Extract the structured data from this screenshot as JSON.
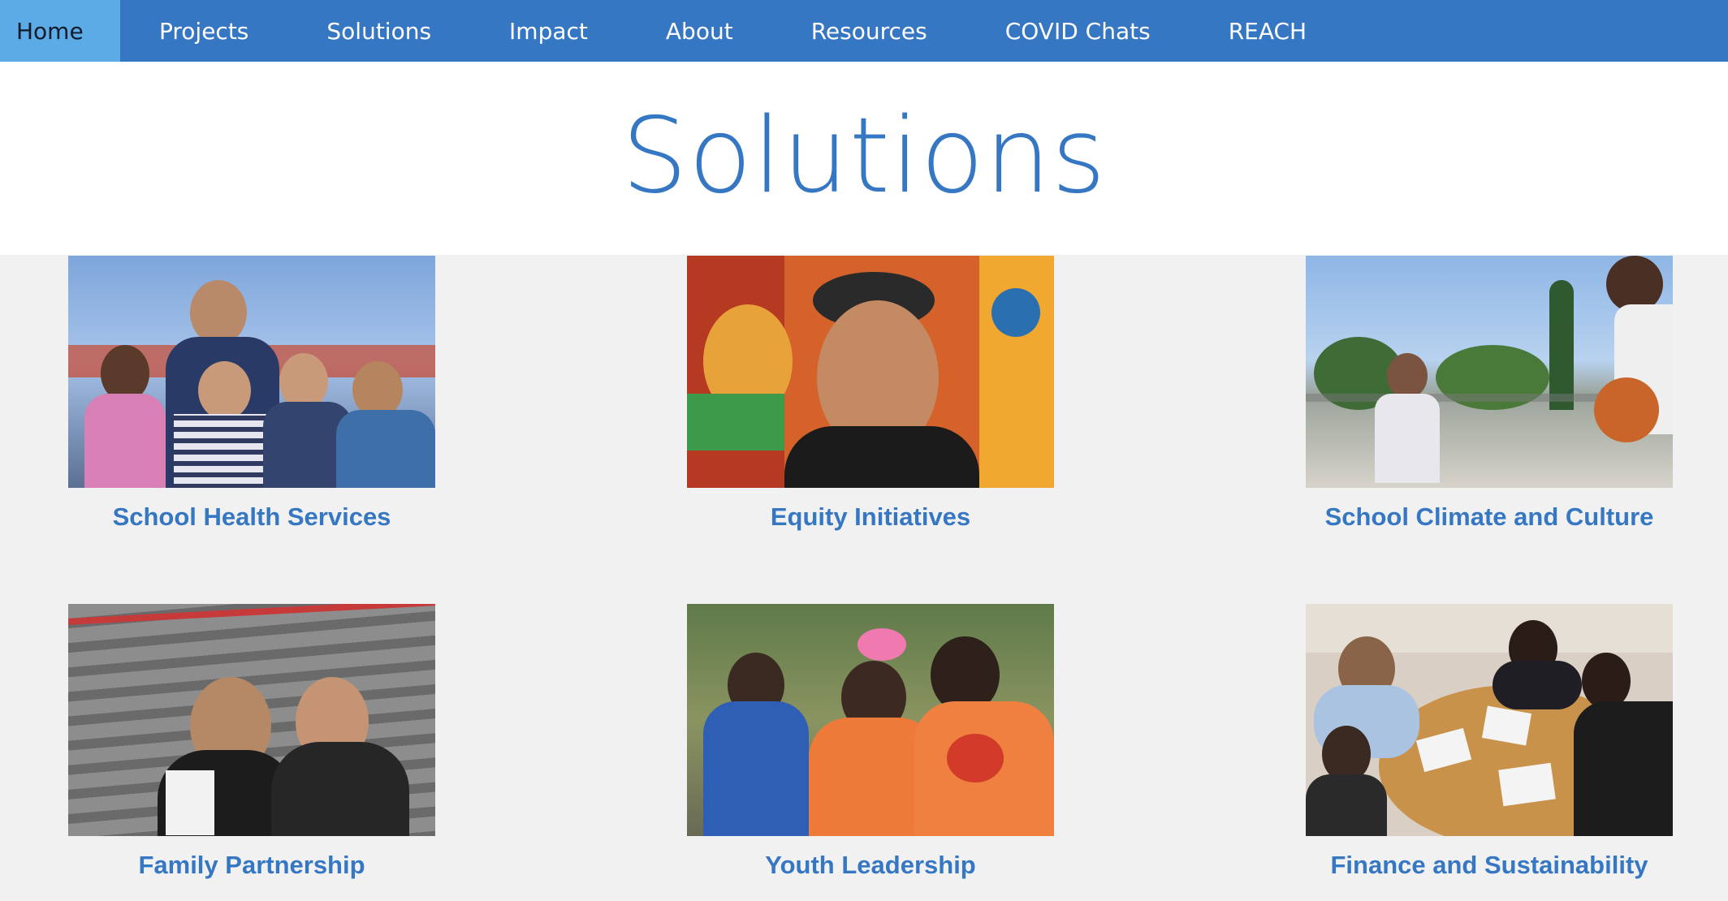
{
  "nav": {
    "items": [
      {
        "label": "Home",
        "active": true
      },
      {
        "label": "Projects"
      },
      {
        "label": "Solutions"
      },
      {
        "label": "Impact"
      },
      {
        "label": "About"
      },
      {
        "label": "Resources"
      },
      {
        "label": "COVID Chats"
      },
      {
        "label": "REACH"
      }
    ]
  },
  "header": {
    "title": "Solutions"
  },
  "cards": [
    {
      "caption": "School Health Services",
      "photo_subject": "group of children with adult outdoors"
    },
    {
      "caption": "Equity Initiatives",
      "photo_subject": "teen boy in cap in front of mural"
    },
    {
      "caption": "School Climate and Culture",
      "photo_subject": "kids playing basketball"
    },
    {
      "caption": "Family Partnership",
      "photo_subject": "mother and daughter on stairs"
    },
    {
      "caption": "Youth Leadership",
      "photo_subject": "group of girls in orange shirts"
    },
    {
      "caption": "Finance and Sustainability",
      "photo_subject": "meeting around round table"
    }
  ],
  "colors": {
    "nav_bg": "#3677c4",
    "nav_active_bg": "#5caae6",
    "accent": "#3677c4",
    "page_bg": "#f1f1f1"
  }
}
